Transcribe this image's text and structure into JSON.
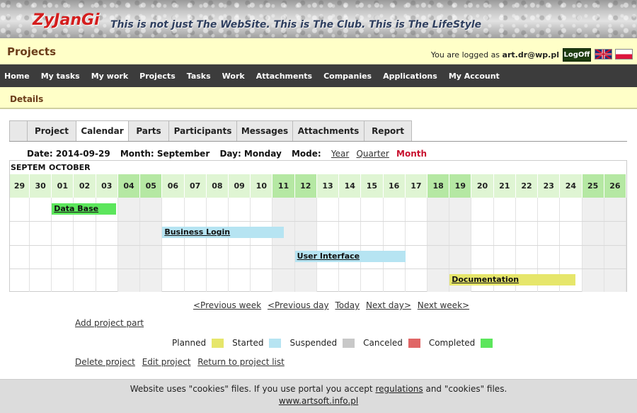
{
  "banner": {
    "logo": "ZyJanGi",
    "slogan": "This is not just The WebSite. This is The Club. This is The LifeStyle"
  },
  "header": {
    "title": "Projects",
    "login_prefix": "You are logged as",
    "user": "art.dr@wp.pl",
    "logoff": "LogOff",
    "flags": [
      "uk-flag",
      "pl-flag"
    ]
  },
  "nav": [
    "Home",
    "My tasks",
    "My work",
    "Projects",
    "Tasks",
    "Work",
    "Attachments",
    "Companies",
    "Applications",
    "My Account"
  ],
  "details": {
    "title": "Details"
  },
  "tabs": [
    {
      "label": "",
      "active": false
    },
    {
      "label": "Project",
      "active": false
    },
    {
      "label": "Calendar",
      "active": true
    },
    {
      "label": "Parts",
      "active": false
    },
    {
      "label": "Participants",
      "active": false
    },
    {
      "label": "Messages",
      "active": false
    },
    {
      "label": "Attachments",
      "active": false
    },
    {
      "label": "Report",
      "active": false
    }
  ],
  "date_row": {
    "date": "Date: 2014-09-29",
    "month": "Month: September",
    "day": "Day: Monday",
    "mode_label": "Mode:",
    "modes": [
      "Year",
      "Quarter"
    ],
    "mode_active": "Month"
  },
  "calendar": {
    "months": [
      "SEPTEM",
      "OCTOBER"
    ],
    "days": [
      {
        "d": "29",
        "weekend": false
      },
      {
        "d": "30",
        "weekend": false
      },
      {
        "d": "01",
        "weekend": false
      },
      {
        "d": "02",
        "weekend": false
      },
      {
        "d": "03",
        "weekend": false
      },
      {
        "d": "04",
        "weekend": true
      },
      {
        "d": "05",
        "weekend": true
      },
      {
        "d": "06",
        "weekend": false
      },
      {
        "d": "07",
        "weekend": false
      },
      {
        "d": "08",
        "weekend": false
      },
      {
        "d": "09",
        "weekend": false
      },
      {
        "d": "10",
        "weekend": false
      },
      {
        "d": "11",
        "weekend": true
      },
      {
        "d": "12",
        "weekend": true
      },
      {
        "d": "13",
        "weekend": false
      },
      {
        "d": "14",
        "weekend": false
      },
      {
        "d": "15",
        "weekend": false
      },
      {
        "d": "16",
        "weekend": false
      },
      {
        "d": "17",
        "weekend": false
      },
      {
        "d": "18",
        "weekend": true
      },
      {
        "d": "19",
        "weekend": true
      },
      {
        "d": "20",
        "weekend": false
      },
      {
        "d": "21",
        "weekend": false
      },
      {
        "d": "22",
        "weekend": false
      },
      {
        "d": "23",
        "weekend": false
      },
      {
        "d": "24",
        "weekend": false
      },
      {
        "d": "25",
        "weekend": true
      },
      {
        "d": "26",
        "weekend": true
      }
    ],
    "parts": [
      {
        "name": "Data Base",
        "start": 2,
        "end": 4.9,
        "row": 0,
        "color": "#5ce65c"
      },
      {
        "name": "Business Login",
        "start": 7,
        "end": 12.5,
        "row": 1,
        "color": "#b6e4f2"
      },
      {
        "name": "User Interface",
        "start": 13,
        "end": 18,
        "row": 2,
        "color": "#b6e4f2"
      },
      {
        "name": "Documentation",
        "start": 20,
        "end": 25.7,
        "row": 3,
        "color": "#e6e66b"
      }
    ]
  },
  "pager": [
    "<Previous week",
    "<Previous day",
    "Today",
    "Next day>",
    "Next week>"
  ],
  "add_part": "Add project part",
  "legend": [
    {
      "label": "Planned",
      "color": "#e6e66b"
    },
    {
      "label": "Started",
      "color": "#b6e4f2"
    },
    {
      "label": "Suspended",
      "color": "#c8c8c8"
    },
    {
      "label": "Canceled",
      "color": "#e06666"
    },
    {
      "label": "Completed",
      "color": "#5ce65c"
    }
  ],
  "actions": [
    "Delete project",
    "Edit project",
    "Return to project list"
  ],
  "footer": {
    "text_before": "Website uses \"cookies\" files. If you use portal you accept",
    "link": "regulations",
    "text_after": "and \"cookies\" files.",
    "site": "www.artsoft.info.pl"
  }
}
